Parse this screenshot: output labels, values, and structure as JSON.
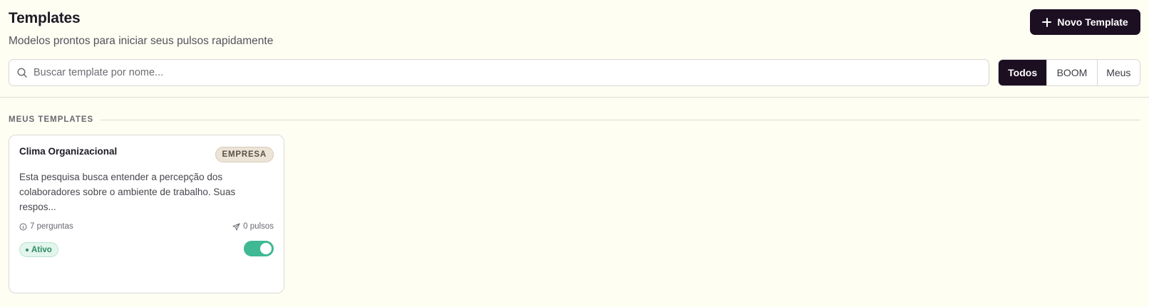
{
  "header": {
    "title": "Templates",
    "subtitle": "Modelos prontos para iniciar seus pulsos rapidamente",
    "new_button_label": "Novo Template"
  },
  "search": {
    "placeholder": "Buscar template por nome...",
    "value": ""
  },
  "filters": {
    "items": [
      {
        "label": "Todos",
        "active": true
      },
      {
        "label": "BOOM",
        "active": false
      },
      {
        "label": "Meus",
        "active": false
      }
    ]
  },
  "section": {
    "title": "MEUS TEMPLATES"
  },
  "cards": [
    {
      "title": "Clima Organizacional",
      "badge": "EMPRESA",
      "description": "Esta pesquisa busca entender a percepção dos colaboradores sobre o ambiente de trabalho. Suas respos...",
      "questions": "7 perguntas",
      "pulses": "0 pulsos",
      "status": "Ativo",
      "enabled": true
    }
  ],
  "colors": {
    "background": "#fefef3",
    "primary_dark": "#1c0f22",
    "badge_bg": "#ece4d6",
    "status_green": "#2b8a62",
    "toggle_on": "#3fb894"
  },
  "icons": {
    "new_button": "plus-icon",
    "search": "search-icon",
    "questions": "info-circle-icon",
    "pulses": "send-icon"
  }
}
